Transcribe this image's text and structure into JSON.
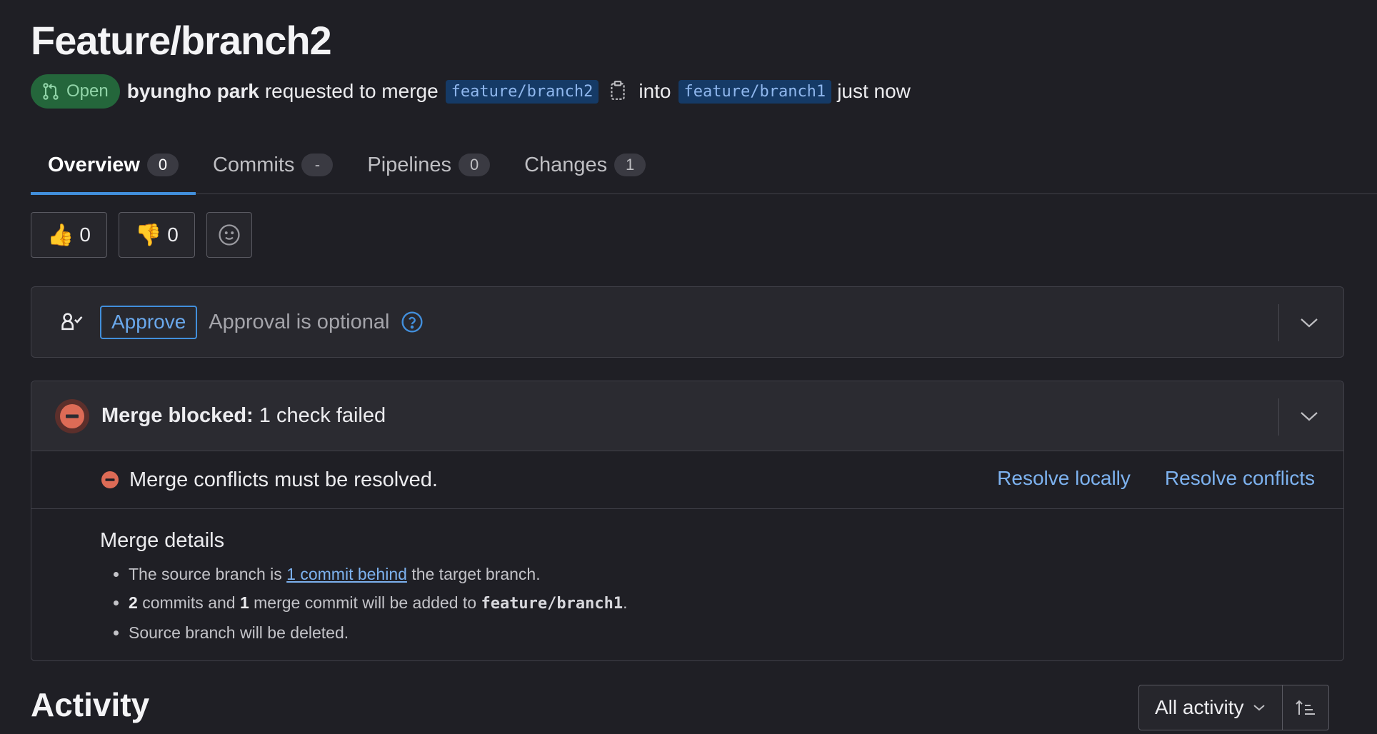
{
  "title": "Feature/branch2",
  "meta": {
    "status": "Open",
    "author": "byungho park",
    "action_text": "requested to merge",
    "source_branch": "feature/branch2",
    "into_text": "into",
    "target_branch": "feature/branch1",
    "time": "just now"
  },
  "tabs": [
    {
      "label": "Overview",
      "count": "0",
      "active": true
    },
    {
      "label": "Commits",
      "count": "-"
    },
    {
      "label": "Pipelines",
      "count": "0"
    },
    {
      "label": "Changes",
      "count": "1"
    }
  ],
  "reactions": {
    "thumbs_up": {
      "emoji": "👍",
      "count": "0"
    },
    "thumbs_down": {
      "emoji": "👎",
      "count": "0"
    }
  },
  "approval": {
    "button_label": "Approve",
    "text": "Approval is optional"
  },
  "merge": {
    "status_bold": "Merge blocked:",
    "status_text": "1 check failed",
    "conflict_text": "Merge conflicts must be resolved.",
    "resolve_locally": "Resolve locally",
    "resolve_conflicts": "Resolve conflicts",
    "details_title": "Merge details",
    "details": {
      "item1_prefix": "The source branch is",
      "item1_link": "1 commit behind",
      "item1_suffix": "the target branch.",
      "item2_commits": "2",
      "item2_mid": "commits and",
      "item2_merge": "1",
      "item2_suffix": "merge commit will be added to",
      "item2_branch": "feature/branch1",
      "item2_end": ".",
      "item3": "Source branch will be deleted."
    }
  },
  "activity": {
    "title": "Activity",
    "filter": "All activity"
  },
  "colors": {
    "background": "#1f1f25",
    "accent_blue": "#428fdc",
    "open_badge": "#24663b",
    "danger": "#dd6b56"
  }
}
